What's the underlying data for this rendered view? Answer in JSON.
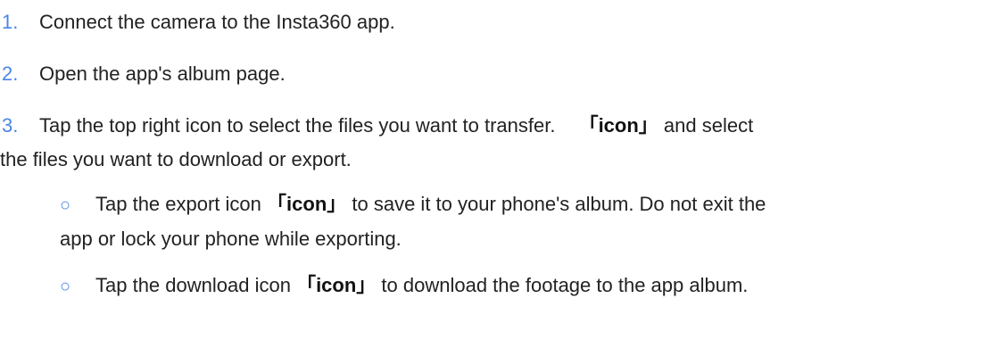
{
  "steps": [
    {
      "num": "1.",
      "text": "Connect the camera to the Insta360 app."
    },
    {
      "num": "2.",
      "text": "Open the app's album page."
    },
    {
      "num": "3.",
      "text_before": "Tap the top right icon to select the files you want to transfer.",
      "icon_label": "「icon」",
      "text_after": "and select",
      "continuation": "the files you want to download or export."
    }
  ],
  "bullets": [
    {
      "symbol": "○",
      "text_before": "Tap the export icon",
      "icon_label": "「icon」",
      "text_after": "to save it to your phone's album. Do not exit the",
      "continuation": "app or lock your phone while exporting."
    },
    {
      "symbol": "○",
      "text_before": "Tap the download icon",
      "icon_label": "「icon」",
      "text_after": "to download the footage to the app album."
    }
  ],
  "colors": {
    "number_accent": "#4a86e8",
    "text": "#222222"
  }
}
